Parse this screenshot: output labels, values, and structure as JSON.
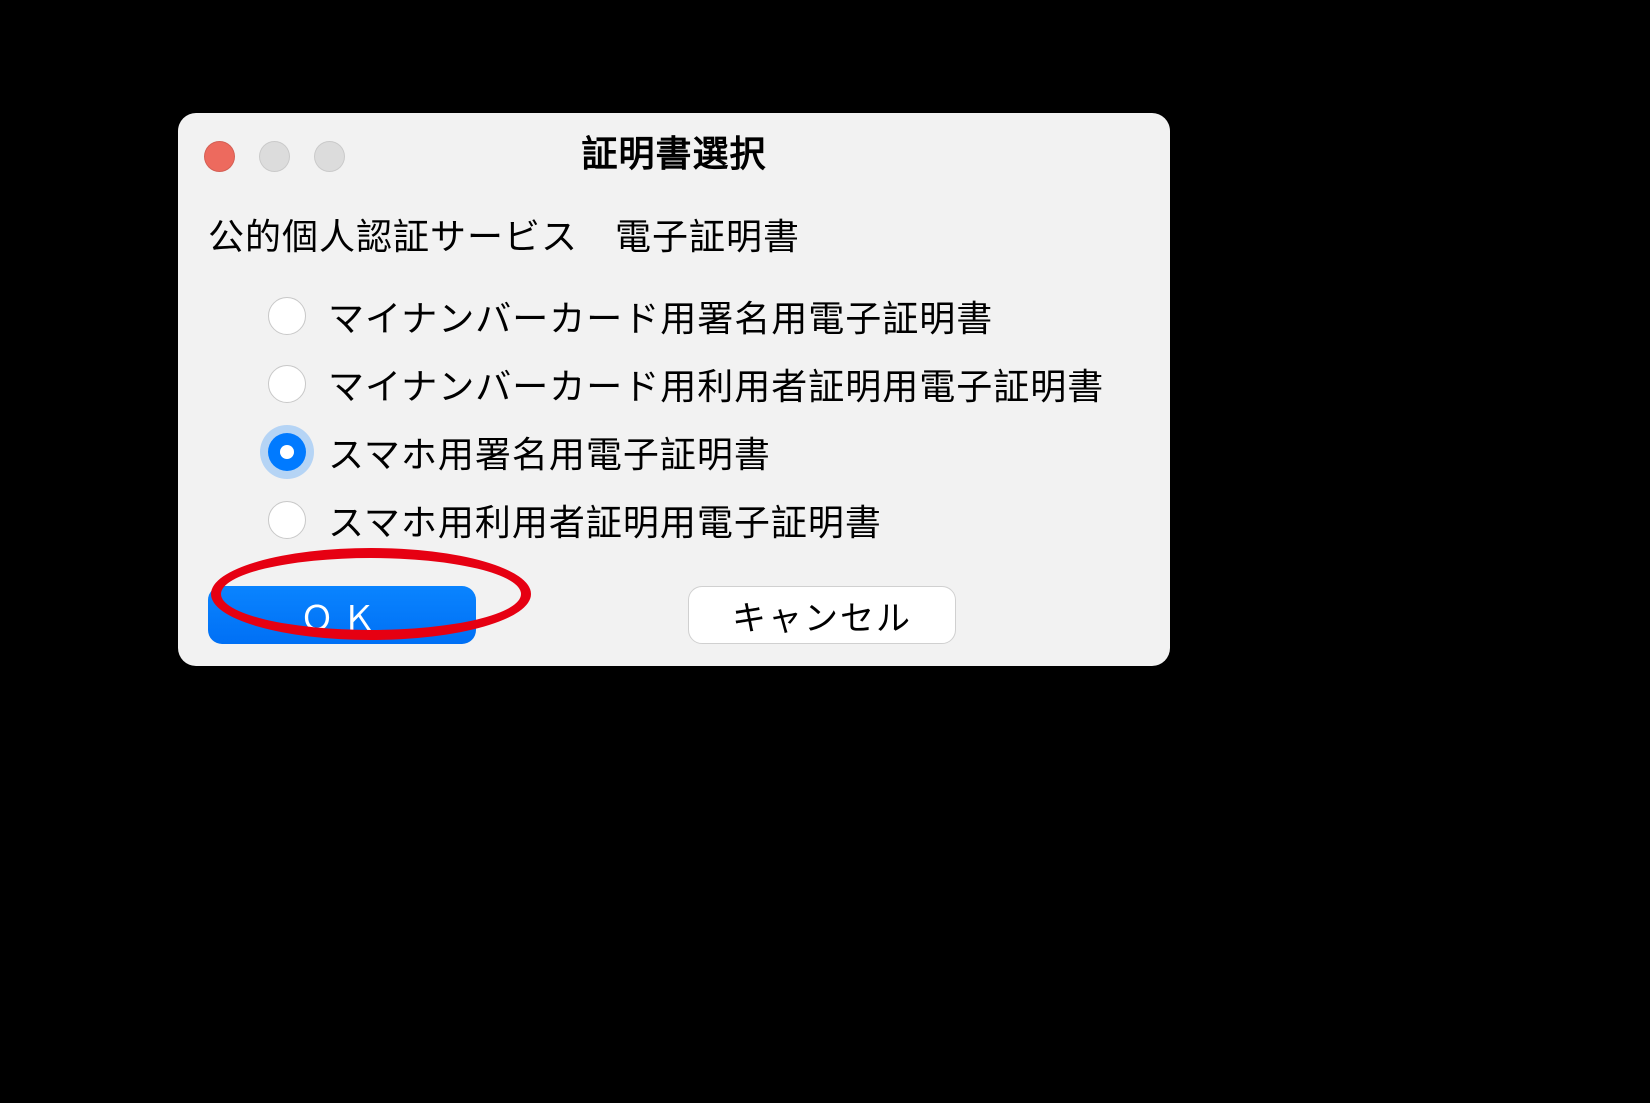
{
  "window": {
    "title": "証明書選択"
  },
  "content": {
    "heading": "公的個人認証サービス　電子証明書",
    "options": [
      {
        "label": "マイナンバーカード用署名用電子証明書",
        "selected": false
      },
      {
        "label": "マイナンバーカード用利用者証明用電子証明書",
        "selected": false
      },
      {
        "label": "スマホ用署名用電子証明書",
        "selected": true
      },
      {
        "label": "スマホ用利用者証明用電子証明書",
        "selected": false
      }
    ]
  },
  "buttons": {
    "ok": "ＯＫ",
    "cancel": "キャンセル"
  },
  "annotation": {
    "highlight_color": "#e60012"
  }
}
